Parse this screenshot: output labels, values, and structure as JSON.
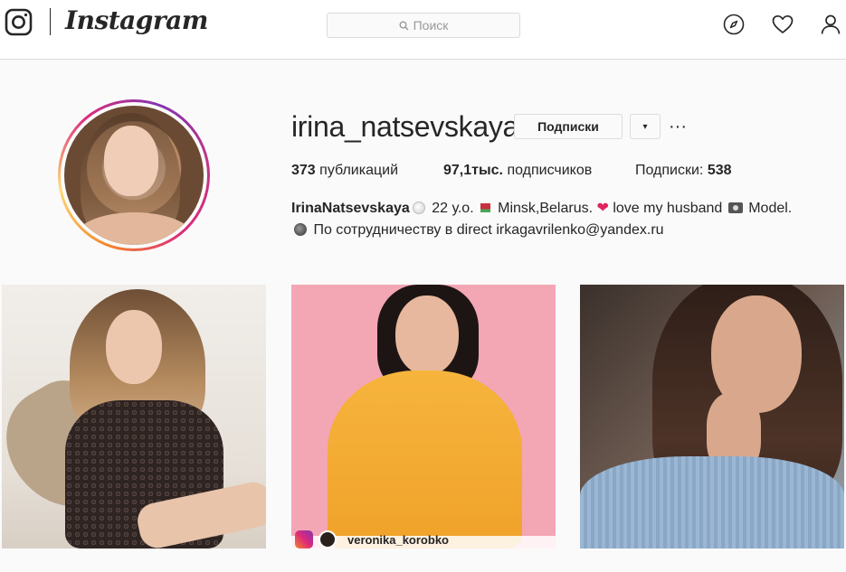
{
  "header": {
    "wordmark": "Instagram",
    "search_placeholder": "Поиск",
    "icons": [
      "instagram-glyph-icon",
      "search-icon",
      "compass-icon",
      "heart-icon",
      "profile-icon"
    ]
  },
  "profile": {
    "username": "irina_natsevskaya",
    "follow_button": "Подписки",
    "dropdown_glyph": "▾",
    "more_glyph": "···",
    "stats": {
      "posts_count": "373",
      "posts_label": "публикаций",
      "followers_count": "97,1тыс.",
      "followers_label": "подписчиков",
      "following_label": "Подписки:",
      "following_count": "538"
    },
    "bio": {
      "full_name": "IrinaNatsevskaya",
      "line1_age": "22 у.о.",
      "line1_location": "Minsk,Belarus.",
      "line1_love": "love my husband",
      "line1_model": "Model.",
      "line2": "По сотрудничеству в direct irkagavrilenko@yandex.ru"
    }
  },
  "posts": [
    {
      "tag_text": ""
    },
    {
      "tag_text": "veronika_korobko"
    },
    {
      "tag_text": ""
    }
  ],
  "colors": {
    "text": "#262626",
    "border": "#dbdbdb",
    "background": "#fafafa",
    "story_ring": [
      "#f58529",
      "#dd2a7b",
      "#8134af"
    ]
  }
}
